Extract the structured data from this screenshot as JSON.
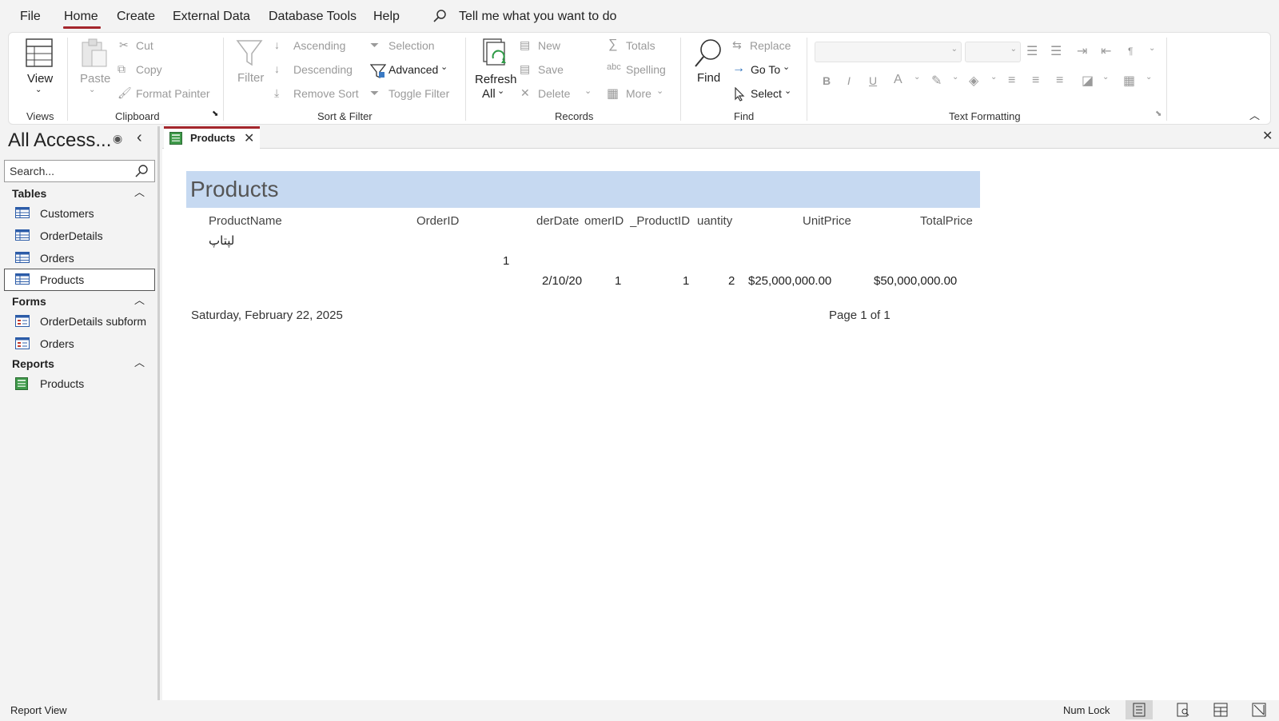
{
  "menu": {
    "file": "File",
    "home": "Home",
    "create": "Create",
    "external_data": "External Data",
    "database_tools": "Database Tools",
    "help": "Help",
    "tell_me": "Tell me what you want to do"
  },
  "ribbon": {
    "views": {
      "view": "View",
      "group": "Views"
    },
    "clipboard": {
      "paste": "Paste",
      "cut": "Cut",
      "copy": "Copy",
      "format_painter": "Format Painter",
      "group": "Clipboard"
    },
    "sort_filter": {
      "filter": "Filter",
      "ascending": "Ascending",
      "descending": "Descending",
      "remove_sort": "Remove Sort",
      "selection": "Selection",
      "advanced": "Advanced",
      "toggle_filter": "Toggle Filter",
      "group": "Sort & Filter"
    },
    "records": {
      "refresh": "Refresh",
      "refresh_all": "All",
      "new": "New",
      "save": "Save",
      "delete": "Delete",
      "totals": "Totals",
      "spelling": "Spelling",
      "more": "More",
      "group": "Records"
    },
    "find": {
      "find": "Find",
      "replace": "Replace",
      "goto": "Go To",
      "select": "Select",
      "group": "Find"
    },
    "text_formatting": {
      "group": "Text Formatting"
    }
  },
  "nav": {
    "title": "All Access...",
    "search_placeholder": "Search...",
    "sections": {
      "tables": "Tables",
      "forms": "Forms",
      "reports": "Reports"
    },
    "tables": [
      "Customers",
      "OrderDetails",
      "Orders",
      "Products"
    ],
    "forms": [
      "OrderDetails subform",
      "Orders"
    ],
    "reports": [
      "Products"
    ]
  },
  "doc": {
    "tab_label": "Products",
    "report_title": "Products",
    "columns": [
      "ProductName",
      "OrderID",
      "derDate",
      "omerID",
      "_ProductID",
      "uantity",
      "UnitPrice",
      "TotalPrice"
    ],
    "product_name": "لپتاپ",
    "order_id": "1",
    "row": {
      "order_date": "2/10/20",
      "customer_id": "1",
      "product_id": "1",
      "quantity": "2",
      "unit_price": "$25,000,000.00",
      "total_price": "$50,000,000.00"
    },
    "footer_date": "Saturday, February 22, 2025",
    "footer_page": "Page 1 of 1"
  },
  "status": {
    "view": "Report View",
    "num_lock": "Num Lock"
  },
  "colors": {
    "accent": "#a4262c",
    "report_header": "#c6d9f1"
  }
}
